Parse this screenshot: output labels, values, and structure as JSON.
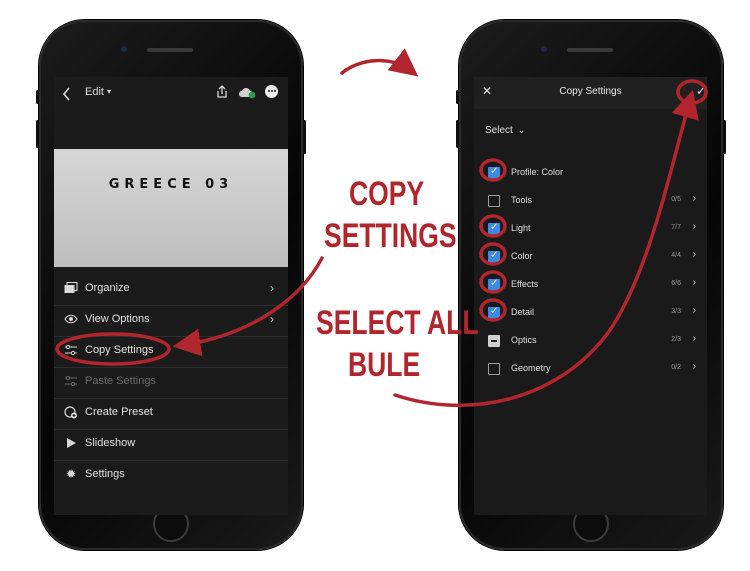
{
  "left_screen": {
    "back_icon": "chevron-left-icon",
    "edit_label": "Edit",
    "share_icon": "share-icon",
    "cloud_icon": "cloud-sync-icon",
    "more_icon": "more-icon",
    "photo_title": "GREECE 03",
    "menu": [
      {
        "label": "Organize",
        "icon": "organize-icon",
        "chevron": true,
        "enabled": true
      },
      {
        "label": "View Options",
        "icon": "view-options-icon",
        "chevron": true,
        "enabled": true
      },
      {
        "label": "Copy Settings",
        "icon": "copy-settings-icon",
        "chevron": false,
        "enabled": true
      },
      {
        "label": "Paste Settings",
        "icon": "paste-settings-icon",
        "chevron": false,
        "enabled": false
      },
      {
        "label": "Create Preset",
        "icon": "create-preset-icon",
        "chevron": false,
        "enabled": true
      },
      {
        "label": "Slideshow",
        "icon": "play-icon",
        "chevron": false,
        "enabled": true
      },
      {
        "label": "Settings",
        "icon": "gear-icon",
        "chevron": false,
        "enabled": true
      }
    ]
  },
  "right_screen": {
    "close_icon": "close-icon",
    "title": "Copy Settings",
    "confirm_icon": "check-icon",
    "select_label": "Select",
    "options": [
      {
        "label": "Profile: Color",
        "state": "checked",
        "count": ""
      },
      {
        "label": "Tools",
        "state": "unchecked",
        "count": "0/5"
      },
      {
        "label": "Light",
        "state": "checked",
        "count": "7/7"
      },
      {
        "label": "Color",
        "state": "checked",
        "count": "4/4"
      },
      {
        "label": "Effects",
        "state": "checked",
        "count": "6/6"
      },
      {
        "label": "Detail",
        "state": "checked",
        "count": "3/3"
      },
      {
        "label": "Optics",
        "state": "partial",
        "count": "2/3"
      },
      {
        "label": "Geometry",
        "state": "unchecked",
        "count": "0/2"
      }
    ]
  },
  "annotations": {
    "copy_line1": "COPY",
    "copy_line2": "SETTINGS",
    "select_line1": "SELECT ALL",
    "select_line2": "BULE",
    "color": "#b1262c"
  },
  "colors": {
    "checkbox_accent": "#3d8be8",
    "screen_bg": "#1b1b1b"
  }
}
